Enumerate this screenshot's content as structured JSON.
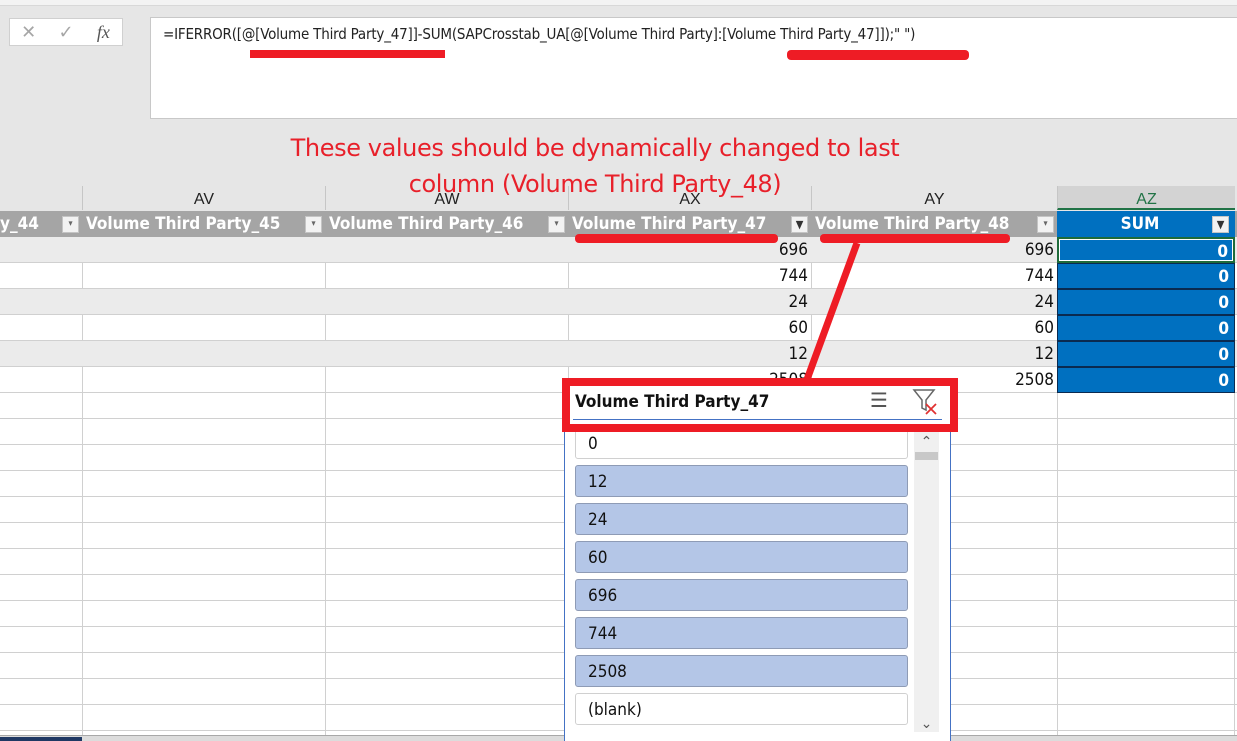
{
  "formula_bar": {
    "cancel_icon": "✕",
    "enter_icon": "✓",
    "fx_label": "fx",
    "formula": "=IFERROR([@[Volume Third Party_47]]-SUM(SAPCrosstab_UA[@[Volume Third Party]:[Volume Third Party_47]]);\" \")"
  },
  "annotation": {
    "line1": "These values should be dynamically changed to last",
    "line2": "column (Volume Third Party_48)",
    "color": "#ee1c25"
  },
  "columns": {
    "letters": [
      "AV",
      "AW",
      "AX",
      "AY",
      "AZ"
    ],
    "active_letter": "AZ"
  },
  "table": {
    "headers": [
      {
        "label": "y_44",
        "filter": "dropdown"
      },
      {
        "label": "Volume Third Party_45",
        "filter": "dropdown"
      },
      {
        "label": "Volume Third Party_46",
        "filter": "dropdown"
      },
      {
        "label": "Volume Third Party_47",
        "filter": "filtered"
      },
      {
        "label": "Volume Third Party_48",
        "filter": "dropdown"
      },
      {
        "label": "SUM",
        "filter": "filtered"
      }
    ],
    "rows": [
      {
        "ax": "696",
        "ay": "696",
        "az": "0"
      },
      {
        "ax": "744",
        "ay": "744",
        "az": "0"
      },
      {
        "ax": "24",
        "ay": "24",
        "az": "0"
      },
      {
        "ax": "60",
        "ay": "60",
        "az": "0"
      },
      {
        "ax": "12",
        "ay": "12",
        "az": "0"
      },
      {
        "ax": "2508",
        "ay": "2508",
        "az": "0"
      }
    ],
    "header_color": "#a5a5a5",
    "sum_color": "#0070c0"
  },
  "slicer": {
    "title": "Volume Third Party_47",
    "multiselect_icon": "multi-select-icon",
    "clear_filter_icon": "clear-filter-icon",
    "items": [
      {
        "label": "0",
        "selected": false
      },
      {
        "label": "12",
        "selected": true
      },
      {
        "label": "24",
        "selected": true
      },
      {
        "label": "60",
        "selected": true
      },
      {
        "label": "696",
        "selected": true
      },
      {
        "label": "744",
        "selected": true
      },
      {
        "label": "2508",
        "selected": true
      },
      {
        "label": "(blank)",
        "selected": false
      }
    ],
    "selected_color": "#b4c6e7"
  }
}
